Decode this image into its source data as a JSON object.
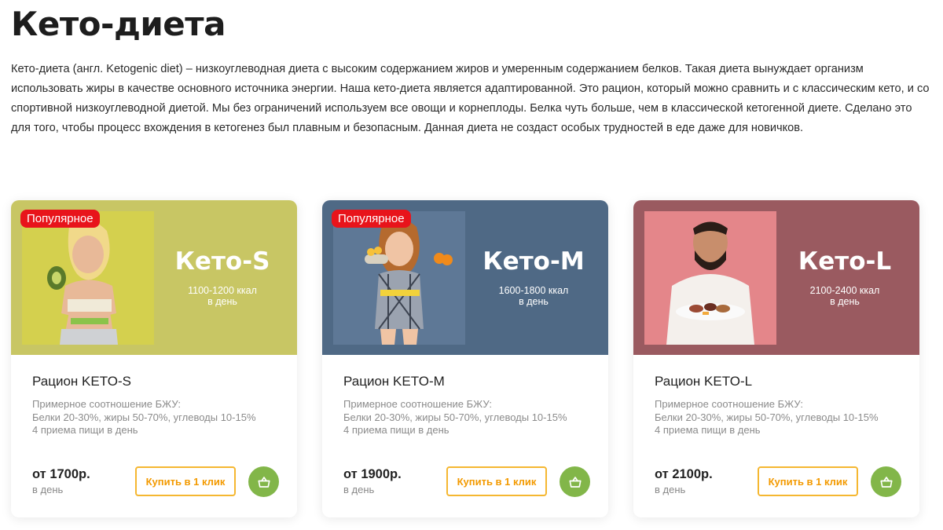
{
  "page": {
    "title": "Кето-диета",
    "intro": "Кето-диета (англ. Ketogenic diet) – низкоуглеводная диета с высоким содержанием жиров и умеренным содержанием белков. Такая диета вынуждает организм использовать жиры в качестве основного источника энергии. Наша кето-диета является адаптированной. Это рацион, который можно сравнить и с классическим кето, и со спортивной низкоуглеводной диетой. Мы без ограничений используем все овощи и корнеплоды. Белка чуть больше, чем в классической кетогенной диете. Сделано это для того, чтобы процесс вхождения в кетогенез был плавным и безопасным. Данная диета не создаст особых трудностей в еде даже для новичков."
  },
  "cards": [
    {
      "badge": "Популярное",
      "banner_name": "Кето-S",
      "banner_kcal": "1100-1200 ккал",
      "banner_perday": "в день",
      "title": "Рацион KETO-S",
      "desc_line1": "Примерное соотношение БЖУ:",
      "desc_line2": "Белки 20-30%, жиры 50-70%, углеводы 10-15%",
      "desc_line3": "4 приема пищи в день",
      "price": "от 1700р.",
      "price_sub": "в день",
      "buy_label": "Купить в 1 клик",
      "banner_color": "#c8c664",
      "photo_bg": "#d4d04e"
    },
    {
      "badge": "Популярное",
      "banner_name": "Кето-M",
      "banner_kcal": "1600-1800 ккал",
      "banner_perday": "в день",
      "title": "Рацион KETO-M",
      "desc_line1": "Примерное соотношение БЖУ:",
      "desc_line2": "Белки 20-30%, жиры 50-70%, углеводы 10-15%",
      "desc_line3": "4 приема пищи в день",
      "price": "от 1900р.",
      "price_sub": "в день",
      "buy_label": "Купить в 1 клик",
      "banner_color": "#4f6985",
      "photo_bg": "#5e7896"
    },
    {
      "badge": "",
      "banner_name": "Кето-L",
      "banner_kcal": "2100-2400 ккал",
      "banner_perday": "в день",
      "title": "Рацион KETO-L",
      "desc_line1": "Примерное соотношение БЖУ:",
      "desc_line2": "Белки 20-30%, жиры 50-70%, углеводы 10-15%",
      "desc_line3": "4 приема пищи в день",
      "price": "от 2100р.",
      "price_sub": "в день",
      "buy_label": "Купить в 1 клик",
      "banner_color": "#9a5a60",
      "photo_bg": "#e4868a"
    }
  ],
  "icons": {
    "cart": "basket-icon"
  }
}
